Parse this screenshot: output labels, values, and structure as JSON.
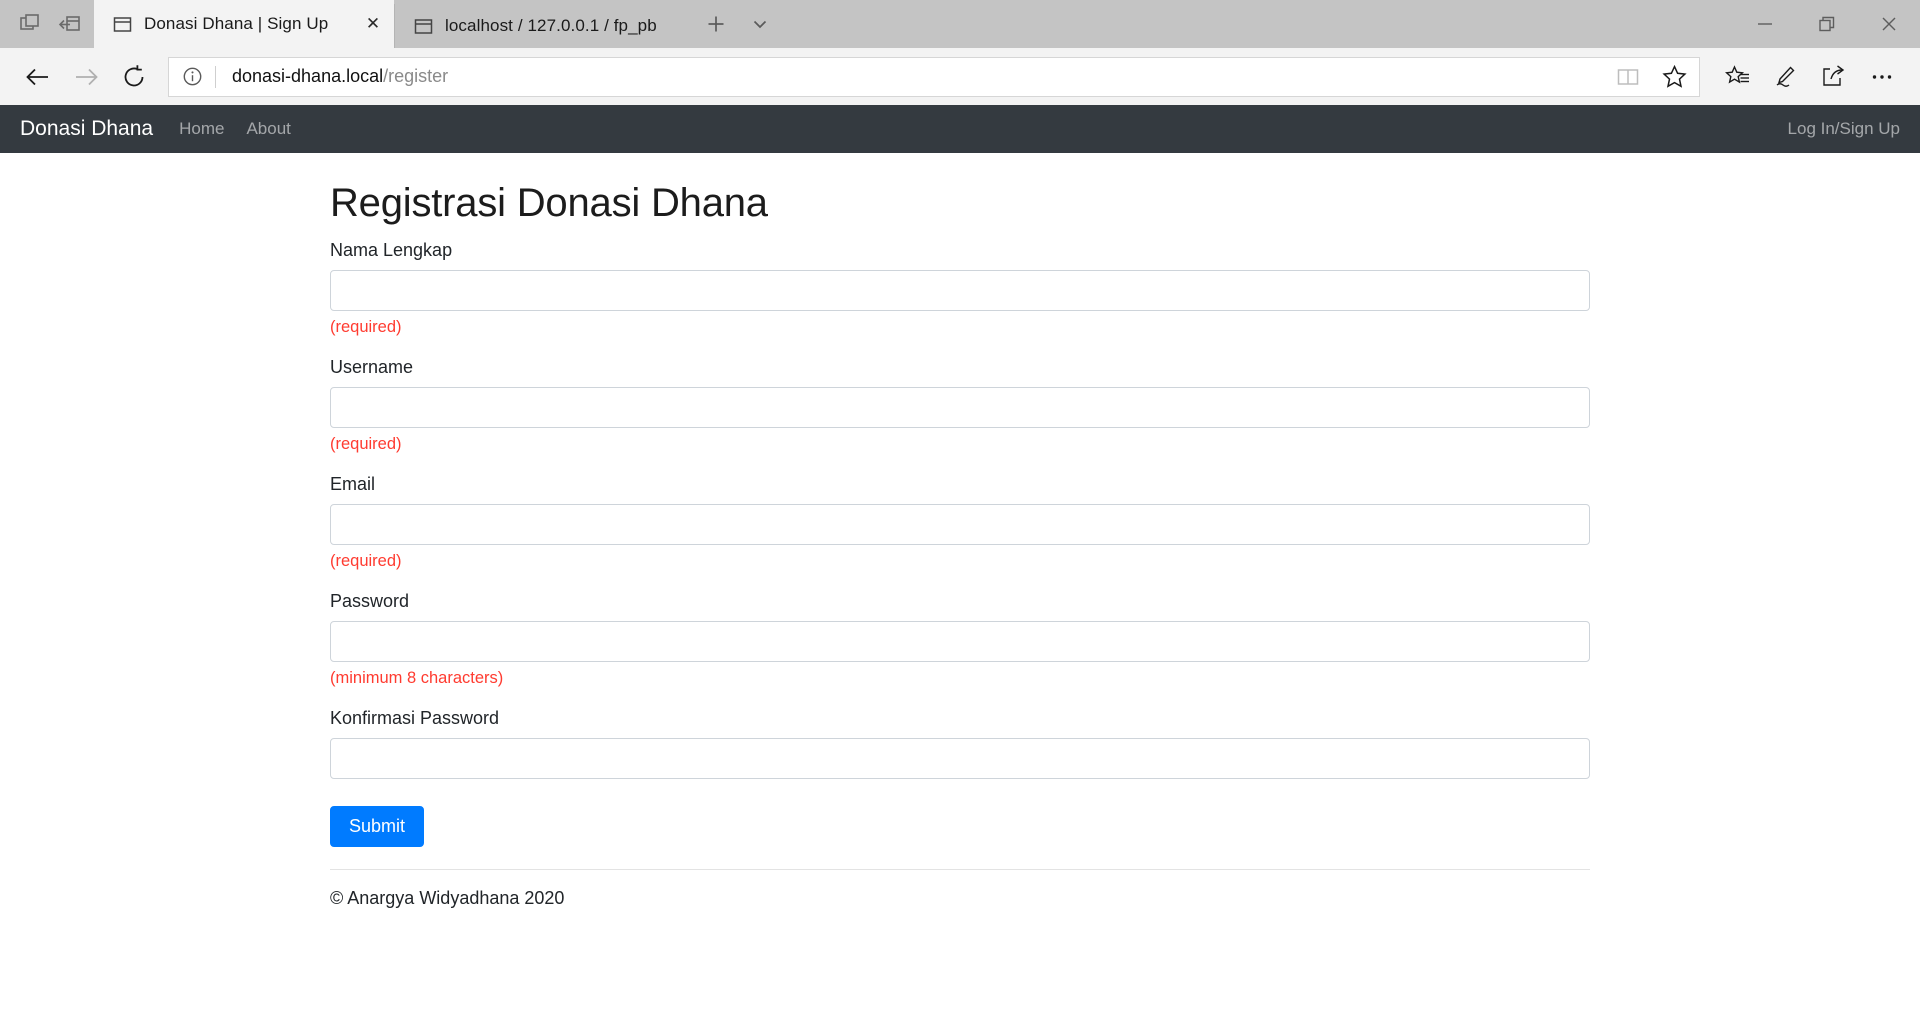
{
  "window": {
    "controls": [
      {
        "name": "minimize",
        "label": "Minimize"
      },
      {
        "name": "restore",
        "label": "Restore"
      },
      {
        "name": "close",
        "label": "Close"
      }
    ]
  },
  "tabstrip": {
    "left_buttons": [
      {
        "name": "tab-preview-icon",
        "label": "Show tab previews"
      },
      {
        "name": "set-tabs-aside-icon",
        "label": "Set these tabs aside"
      }
    ],
    "tabs": [
      {
        "title": "Donasi Dhana | Sign Up",
        "active": true,
        "favicon": "page-icon",
        "close_label": "✕"
      },
      {
        "title": "localhost / 127.0.0.1 / fp_pb",
        "active": false,
        "favicon": "page-icon"
      }
    ],
    "new_tab_label": "+",
    "tab_dropdown_label": "⌄"
  },
  "chrome": {
    "back_label": "Back",
    "forward_label": "Forward",
    "refresh_label": "Refresh",
    "url": {
      "host": "donasi-dhana.local",
      "path": "/register"
    },
    "info_icon": "info-icon",
    "address_icons": [
      {
        "name": "reading-view-icon",
        "label": "Reading view",
        "muted": true
      },
      {
        "name": "favorites-star-icon",
        "label": "Add to favorites",
        "muted": false
      }
    ],
    "toolbar_icons": [
      {
        "name": "favorites-hub-icon",
        "label": "Favorites and Reading list"
      },
      {
        "name": "web-note-icon",
        "label": "Make a Web Note"
      },
      {
        "name": "share-icon",
        "label": "Share"
      },
      {
        "name": "settings-more-icon",
        "label": "Settings and more"
      }
    ]
  },
  "site": {
    "brand": "Donasi Dhana",
    "nav_links": [
      {
        "label": "Home"
      },
      {
        "label": "About"
      }
    ],
    "auth_link": "Log In/Sign Up"
  },
  "page": {
    "title": "Registrasi Donasi Dhana",
    "fields": [
      {
        "name": "nama-lengkap",
        "label": "Nama Lengkap",
        "value": "",
        "placeholder": "",
        "type": "text",
        "help": "(required)"
      },
      {
        "name": "username",
        "label": "Username",
        "value": "",
        "placeholder": "",
        "type": "text",
        "help": "(required)"
      },
      {
        "name": "email",
        "label": "Email",
        "value": "",
        "placeholder": "",
        "type": "text",
        "help": "(required)"
      },
      {
        "name": "password",
        "label": "Password",
        "value": "",
        "placeholder": "",
        "type": "password",
        "help": "(minimum 8 characters)"
      },
      {
        "name": "konfirmasi-password",
        "label": "Konfirmasi Password",
        "value": "",
        "placeholder": "",
        "type": "password",
        "help": ""
      }
    ],
    "submit_label": "Submit",
    "footer": "© Anargya Widyadhana 2020"
  },
  "colors": {
    "navbar_bg": "#343a40",
    "primary": "#007bff",
    "danger": "#ff3b30",
    "chrome_bg": "#f3f3f3",
    "tabstrip_bg": "#c4c4c4"
  }
}
